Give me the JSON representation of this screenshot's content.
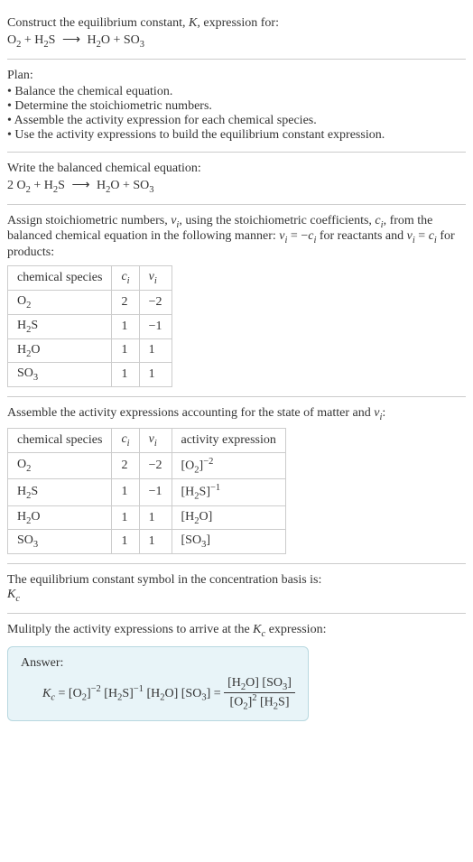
{
  "prompt": {
    "line1": "Construct the equilibrium constant, ",
    "kvar": "K",
    "line1b": ", expression for:",
    "equation_lhs1": "O",
    "equation_lhs2": " + H",
    "equation_lhs3": "S",
    "arrow": "⟶",
    "equation_rhs1": " H",
    "equation_rhs2": "O + SO"
  },
  "plan": {
    "title": "Plan:",
    "items": [
      "Balance the chemical equation.",
      "Determine the stoichiometric numbers.",
      "Assemble the activity expression for each chemical species.",
      "Use the activity expressions to build the equilibrium constant expression."
    ]
  },
  "balanced": {
    "title": "Write the balanced chemical equation:",
    "coef": "2 ",
    "lhs1": "O",
    "lhs2": " + H",
    "lhs3": "S",
    "arrow": "⟶",
    "rhs1": " H",
    "rhs2": "O + SO"
  },
  "stoich": {
    "text1": "Assign stoichiometric numbers, ",
    "nu": "ν",
    "sub_i": "i",
    "text2": ", using the stoichiometric coefficients, ",
    "c": "c",
    "text3": ", from the balanced chemical equation in the following manner: ",
    "eq1a": "ν",
    "eq1b": " = −",
    "eq1c": "c",
    "text4": " for reactants and ",
    "eq2a": "ν",
    "eq2b": " = ",
    "eq2c": "c",
    "text5": " for products:",
    "headers": [
      "chemical species",
      "c",
      "ν"
    ],
    "rows": [
      {
        "species_a": "O",
        "species_sub": "2",
        "c": "2",
        "nu": "−2"
      },
      {
        "species_a": "H",
        "species_sub": "2",
        "species_b": "S",
        "c": "1",
        "nu": "−1"
      },
      {
        "species_a": "H",
        "species_sub": "2",
        "species_b": "O",
        "c": "1",
        "nu": "1"
      },
      {
        "species_a": "SO",
        "species_sub": "3",
        "c": "1",
        "nu": "1"
      }
    ]
  },
  "activity": {
    "text1": "Assemble the activity expressions accounting for the state of matter and ",
    "nu": "ν",
    "sub_i": "i",
    "text2": ":",
    "headers": [
      "chemical species",
      "c",
      "ν",
      "activity expression"
    ],
    "rows": [
      {
        "species_a": "O",
        "species_sub": "2",
        "c": "2",
        "nu": "−2",
        "act_a": "[O",
        "act_sub": "2",
        "act_b": "]",
        "act_sup": "−2"
      },
      {
        "species_a": "H",
        "species_sub": "2",
        "species_b": "S",
        "c": "1",
        "nu": "−1",
        "act_a": "[H",
        "act_sub": "2",
        "act_b": "S]",
        "act_sup": "−1"
      },
      {
        "species_a": "H",
        "species_sub": "2",
        "species_b": "O",
        "c": "1",
        "nu": "1",
        "act_a": "[H",
        "act_sub": "2",
        "act_b": "O]"
      },
      {
        "species_a": "SO",
        "species_sub": "3",
        "c": "1",
        "nu": "1",
        "act_a": "[SO",
        "act_sub": "3",
        "act_b": "]"
      }
    ]
  },
  "symbol": {
    "text": "The equilibrium constant symbol in the concentration basis is:",
    "kc_k": "K",
    "kc_c": "c"
  },
  "final": {
    "text": "Mulitply the activity expressions to arrive at the ",
    "kc_k": "K",
    "kc_c": "c",
    "text2": " expression:",
    "answer_label": "Answer:",
    "kc_eq_k": "K",
    "kc_eq_c": "c",
    "eq": " = [O",
    "eq_sub1": "2",
    "eq2": "]",
    "eq_sup1": "−2",
    "eq3": " [H",
    "eq_sub2": "2",
    "eq4": "S]",
    "eq_sup2": "−1",
    "eq5": " [H",
    "eq_sub3": "2",
    "eq6": "O] [SO",
    "eq_sub4": "3",
    "eq7": "] = ",
    "num1": "[H",
    "num_sub1": "2",
    "num2": "O] [SO",
    "num_sub2": "3",
    "num3": "]",
    "den1": "[O",
    "den_sub1": "2",
    "den2": "]",
    "den_sup1": "2",
    "den3": " [H",
    "den_sub2": "2",
    "den4": "S]"
  }
}
